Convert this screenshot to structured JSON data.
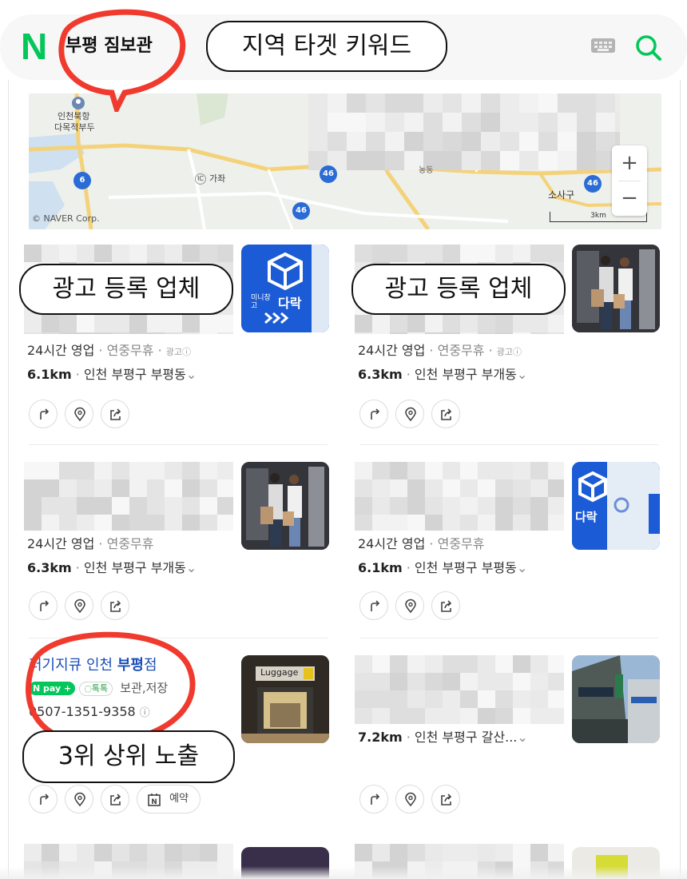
{
  "header": {
    "logo": "N",
    "query": "부평 짐보관",
    "keyword_callout": "지역 타겟 키워드",
    "keyboard_icon": "keyboard-icon",
    "search_icon": "search-icon"
  },
  "map": {
    "labels": {
      "port_line1": "인천북항",
      "port_line2": "다목적부두",
      "gajwa": "가좌",
      "ic": "IC",
      "sosagu": "소사구",
      "ongdong": "농동",
      "copyright": "© NAVER Corp.",
      "scale": "3km"
    },
    "route_shields": [
      "6",
      "46",
      "46",
      "46"
    ],
    "zoom_in": "+",
    "zoom_out": "−"
  },
  "callouts": {
    "ad_left": "광고 등록 업체",
    "ad_right": "광고 등록 업체",
    "rank": "3위 상위 노출"
  },
  "listings": [
    {
      "hours": "24시간 영업",
      "holiday": "연중무휴",
      "ad": "광고ⓘ",
      "distance": "6.1km",
      "address": "인천 부평구 부평동",
      "chevron": "⌄"
    },
    {
      "hours": "24시간 영업",
      "holiday": "연중무휴",
      "ad": "광고ⓘ",
      "distance": "6.3km",
      "address": "인천 부평구 부개동",
      "chevron": "⌄"
    },
    {
      "hours": "24시간 영업",
      "holiday": "연중무휴",
      "distance": "6.3km",
      "address": "인천 부평구 부개동",
      "chevron": "⌄"
    },
    {
      "hours": "24시간 영업",
      "holiday": "연중무휴",
      "distance": "6.1km",
      "address": "인천 부평구 부평동",
      "chevron": "⌄"
    },
    {
      "name_prefix": "러기지큐 인천 ",
      "name_highlight": "부평",
      "name_suffix": "점",
      "npay": "N pay +",
      "talk": "톡톡",
      "category": "보관,저장",
      "phone": "0507-1351-9358",
      "reserve_label": "예약"
    },
    {
      "distance": "7.2km",
      "address": "인천 부평구 갈산...",
      "chevron": "⌄"
    }
  ],
  "thumbs": {
    "brand_text": "다락",
    "brand_sub": "미니창고",
    "shop_sign": "Luggage"
  },
  "colors": {
    "naver_green": "#03c75a",
    "highlight_red": "#f03a2e",
    "link_blue": "#1a4eb8",
    "brand_blue": "#1b5bd6"
  }
}
